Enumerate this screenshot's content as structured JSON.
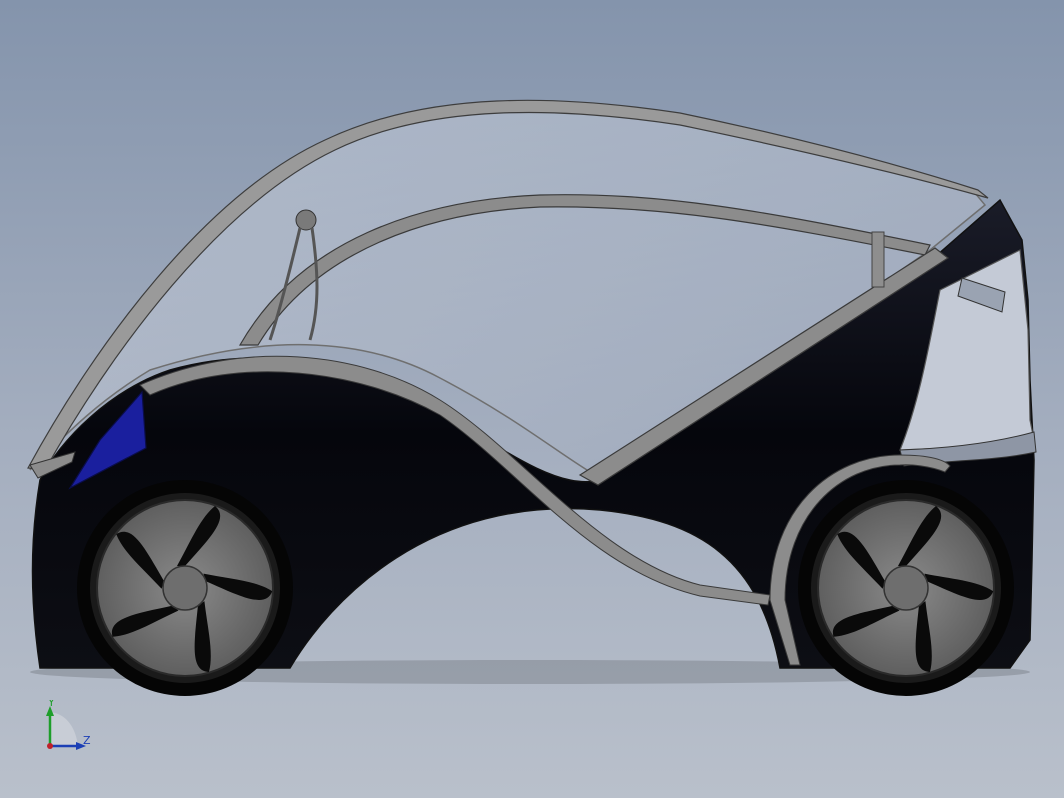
{
  "viewport": {
    "background_top": "#8494ac",
    "background_bottom": "#b9c0cb"
  },
  "model": {
    "body_color": "#05060c",
    "glass_color": "#aab4c6",
    "frame_color": "#8a8a8a",
    "light_color": "#1a1f9e",
    "wheel_color": "#707070"
  },
  "triad": {
    "y_label": "Y",
    "z_label": "Z",
    "y_color": "#1e9e2a",
    "z_color": "#1c3fb5",
    "origin_color": "#c0202a"
  }
}
